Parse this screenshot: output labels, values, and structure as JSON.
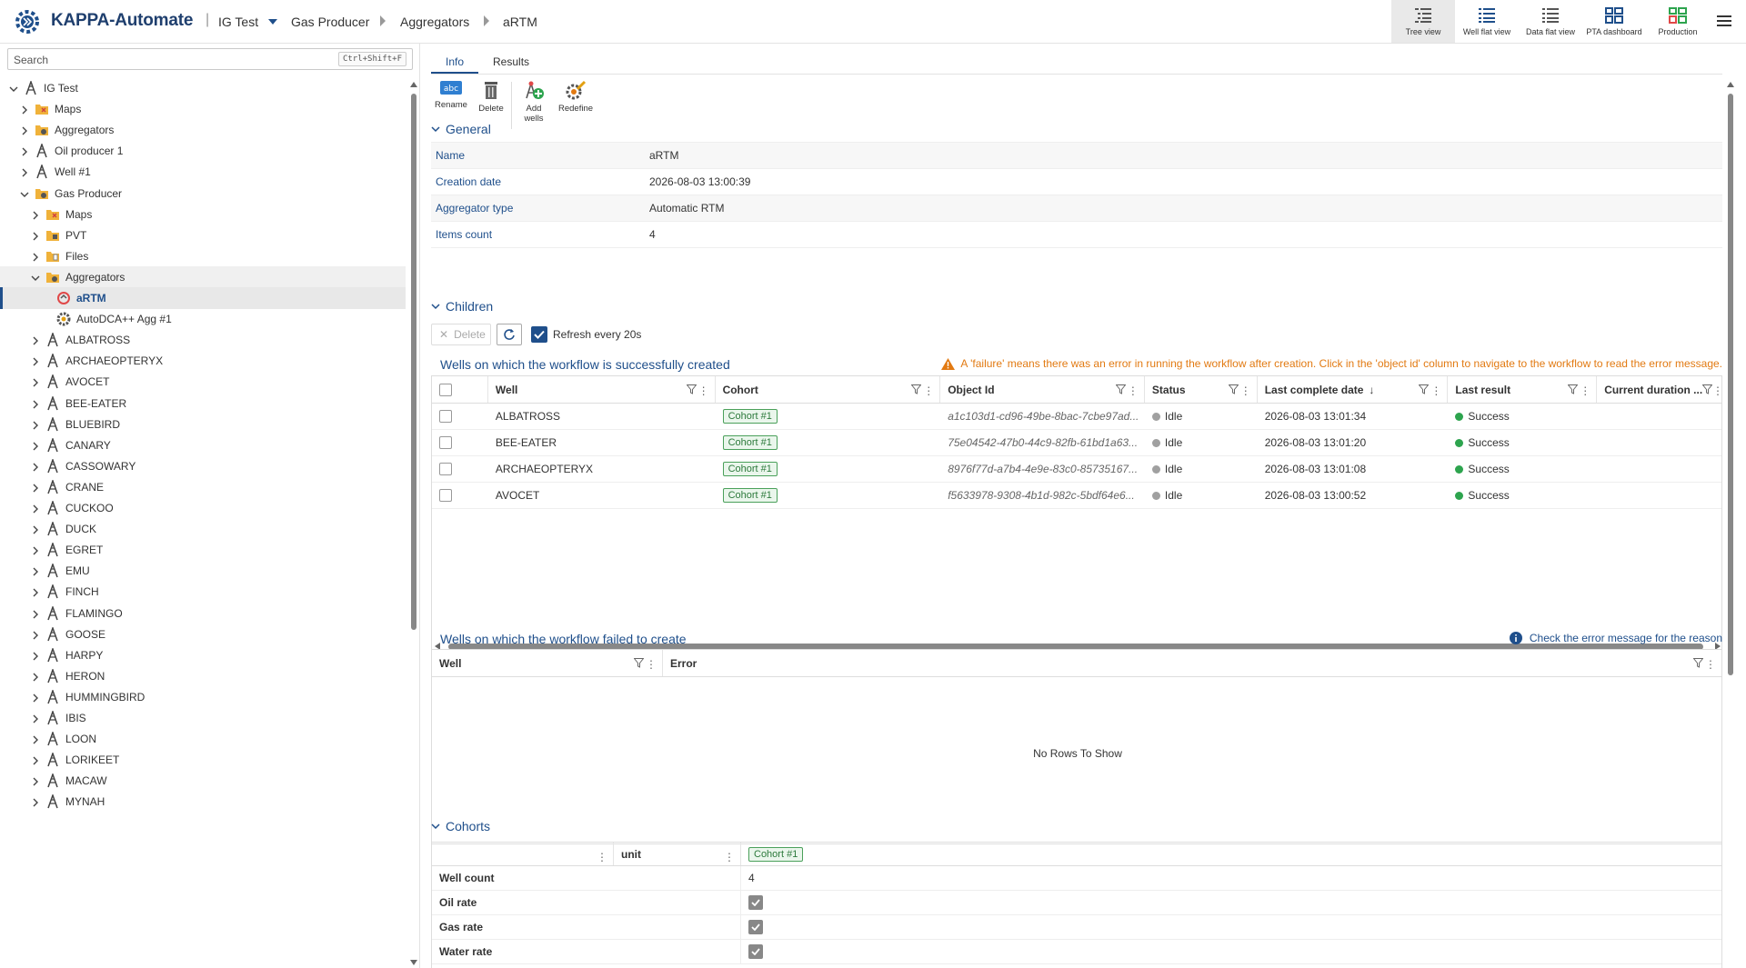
{
  "app": {
    "title": "KAPPA-Automate"
  },
  "breadcrumb": [
    "IG Test",
    "Gas Producer",
    "Aggregators",
    "aRTM"
  ],
  "views": [
    {
      "label": "Tree view",
      "icon": "tree-view-icon",
      "active": true
    },
    {
      "label": "Well flat view",
      "icon": "well-flat-view-icon"
    },
    {
      "label": "Data flat view",
      "icon": "data-flat-view-icon"
    },
    {
      "label": "PTA dashboard",
      "icon": "pta-dashboard-icon"
    },
    {
      "label": "Production",
      "icon": "production-icon"
    }
  ],
  "search": {
    "placeholder": "Search",
    "shortcut": "Ctrl+Shift+F"
  },
  "tree": {
    "nodes": [
      {
        "label": "IG Test",
        "level": 0,
        "icon": "well",
        "open": true
      },
      {
        "label": "Maps",
        "level": 1,
        "icon": "folder-map"
      },
      {
        "label": "Aggregators",
        "level": 1,
        "icon": "folder-agg"
      },
      {
        "label": "Oil producer 1",
        "level": 1,
        "icon": "well"
      },
      {
        "label": "Well #1",
        "level": 1,
        "icon": "well"
      },
      {
        "label": "Gas Producer",
        "level": 1,
        "icon": "folder-agg",
        "open": true
      },
      {
        "label": "Maps",
        "level": 2,
        "icon": "folder-map"
      },
      {
        "label": "PVT",
        "level": 2,
        "icon": "folder-pvt"
      },
      {
        "label": "Files",
        "level": 2,
        "icon": "folder-files"
      },
      {
        "label": "Aggregators",
        "level": 2,
        "icon": "folder-agg",
        "open": true,
        "hl": true
      },
      {
        "label": "aRTM",
        "level": 3,
        "icon": "rtm",
        "leaf": true,
        "selected": true
      },
      {
        "label": "AutoDCA++ Agg #1",
        "level": 3,
        "icon": "gear",
        "leaf": true
      },
      {
        "label": "ALBATROSS",
        "level": 2,
        "icon": "well"
      },
      {
        "label": "ARCHAEOPTERYX",
        "level": 2,
        "icon": "well"
      },
      {
        "label": "AVOCET",
        "level": 2,
        "icon": "well"
      },
      {
        "label": "BEE-EATER",
        "level": 2,
        "icon": "well"
      },
      {
        "label": "BLUEBIRD",
        "level": 2,
        "icon": "well"
      },
      {
        "label": "CANARY",
        "level": 2,
        "icon": "well"
      },
      {
        "label": "CASSOWARY",
        "level": 2,
        "icon": "well"
      },
      {
        "label": "CRANE",
        "level": 2,
        "icon": "well"
      },
      {
        "label": "CUCKOO",
        "level": 2,
        "icon": "well"
      },
      {
        "label": "DUCK",
        "level": 2,
        "icon": "well"
      },
      {
        "label": "EGRET",
        "level": 2,
        "icon": "well"
      },
      {
        "label": "EMU",
        "level": 2,
        "icon": "well"
      },
      {
        "label": "FINCH",
        "level": 2,
        "icon": "well"
      },
      {
        "label": "FLAMINGO",
        "level": 2,
        "icon": "well"
      },
      {
        "label": "GOOSE",
        "level": 2,
        "icon": "well"
      },
      {
        "label": "HARPY",
        "level": 2,
        "icon": "well"
      },
      {
        "label": "HERON",
        "level": 2,
        "icon": "well"
      },
      {
        "label": "HUMMINGBIRD",
        "level": 2,
        "icon": "well"
      },
      {
        "label": "IBIS",
        "level": 2,
        "icon": "well"
      },
      {
        "label": "LOON",
        "level": 2,
        "icon": "well"
      },
      {
        "label": "LORIKEET",
        "level": 2,
        "icon": "well"
      },
      {
        "label": "MACAW",
        "level": 2,
        "icon": "well"
      },
      {
        "label": "MYNAH",
        "level": 2,
        "icon": "well"
      }
    ]
  },
  "tabs": [
    "Info",
    "Results"
  ],
  "toolbar": {
    "rename": "Rename",
    "delete": "Delete",
    "add_wells": "Add wells",
    "redefine": "Redefine"
  },
  "general": {
    "title": "General",
    "rows": [
      {
        "k": "Name",
        "v": "aRTM"
      },
      {
        "k": "Creation date",
        "v": "2026-08-03 13:00:39"
      },
      {
        "k": "Aggregator type",
        "v": "Automatic RTM"
      },
      {
        "k": "Items count",
        "v": "4"
      }
    ]
  },
  "children": {
    "title": "Children",
    "delete_label": "Delete",
    "refresh_label": "Refresh every 20s",
    "success_title": "Wells on which the workflow is successfully created",
    "warning": "A 'failure' means there was an error in running the workflow after creation. Click in the 'object id' column to navigate to the workflow to read the error message.",
    "columns": [
      "Well",
      "Cohort",
      "Object Id",
      "Status",
      "Last complete date",
      "Last result",
      "Current duration ..."
    ],
    "rows": [
      {
        "well": "ALBATROSS",
        "cohort": "Cohort #1",
        "oid": "a1c103d1-cd96-49be-8bac-7cbe97ad...",
        "status": "Idle",
        "date": "2026-08-03 13:01:34",
        "result": "Success"
      },
      {
        "well": "BEE-EATER",
        "cohort": "Cohort #1",
        "oid": "75e04542-47b0-44c9-82fb-61bd1a63...",
        "status": "Idle",
        "date": "2026-08-03 13:01:20",
        "result": "Success"
      },
      {
        "well": "ARCHAEOPTERYX",
        "cohort": "Cohort #1",
        "oid": "8976f77d-a7b4-4e9e-83c0-85735167...",
        "status": "Idle",
        "date": "2026-08-03 13:01:08",
        "result": "Success"
      },
      {
        "well": "AVOCET",
        "cohort": "Cohort #1",
        "oid": "f5633978-9308-4b1d-982c-5bdf64e6...",
        "status": "Idle",
        "date": "2026-08-03 13:00:52",
        "result": "Success"
      }
    ],
    "failed_title": "Wells on which the workflow failed to create",
    "failed_info": "Check the error message for the reason",
    "failed_columns": [
      "Well",
      "Error"
    ],
    "no_rows": "No Rows To Show"
  },
  "cohorts": {
    "title": "Cohorts",
    "unit_header": "unit",
    "cohort_header": "Cohort #1",
    "well_count_label": "Well count",
    "well_count_value": "4",
    "rows": [
      "Oil rate",
      "Gas rate",
      "Water rate"
    ]
  },
  "colors": {
    "accent": "#1f4f8b",
    "warning": "#e27a12",
    "success": "#2da44e",
    "idle": "#a0a0a0"
  }
}
